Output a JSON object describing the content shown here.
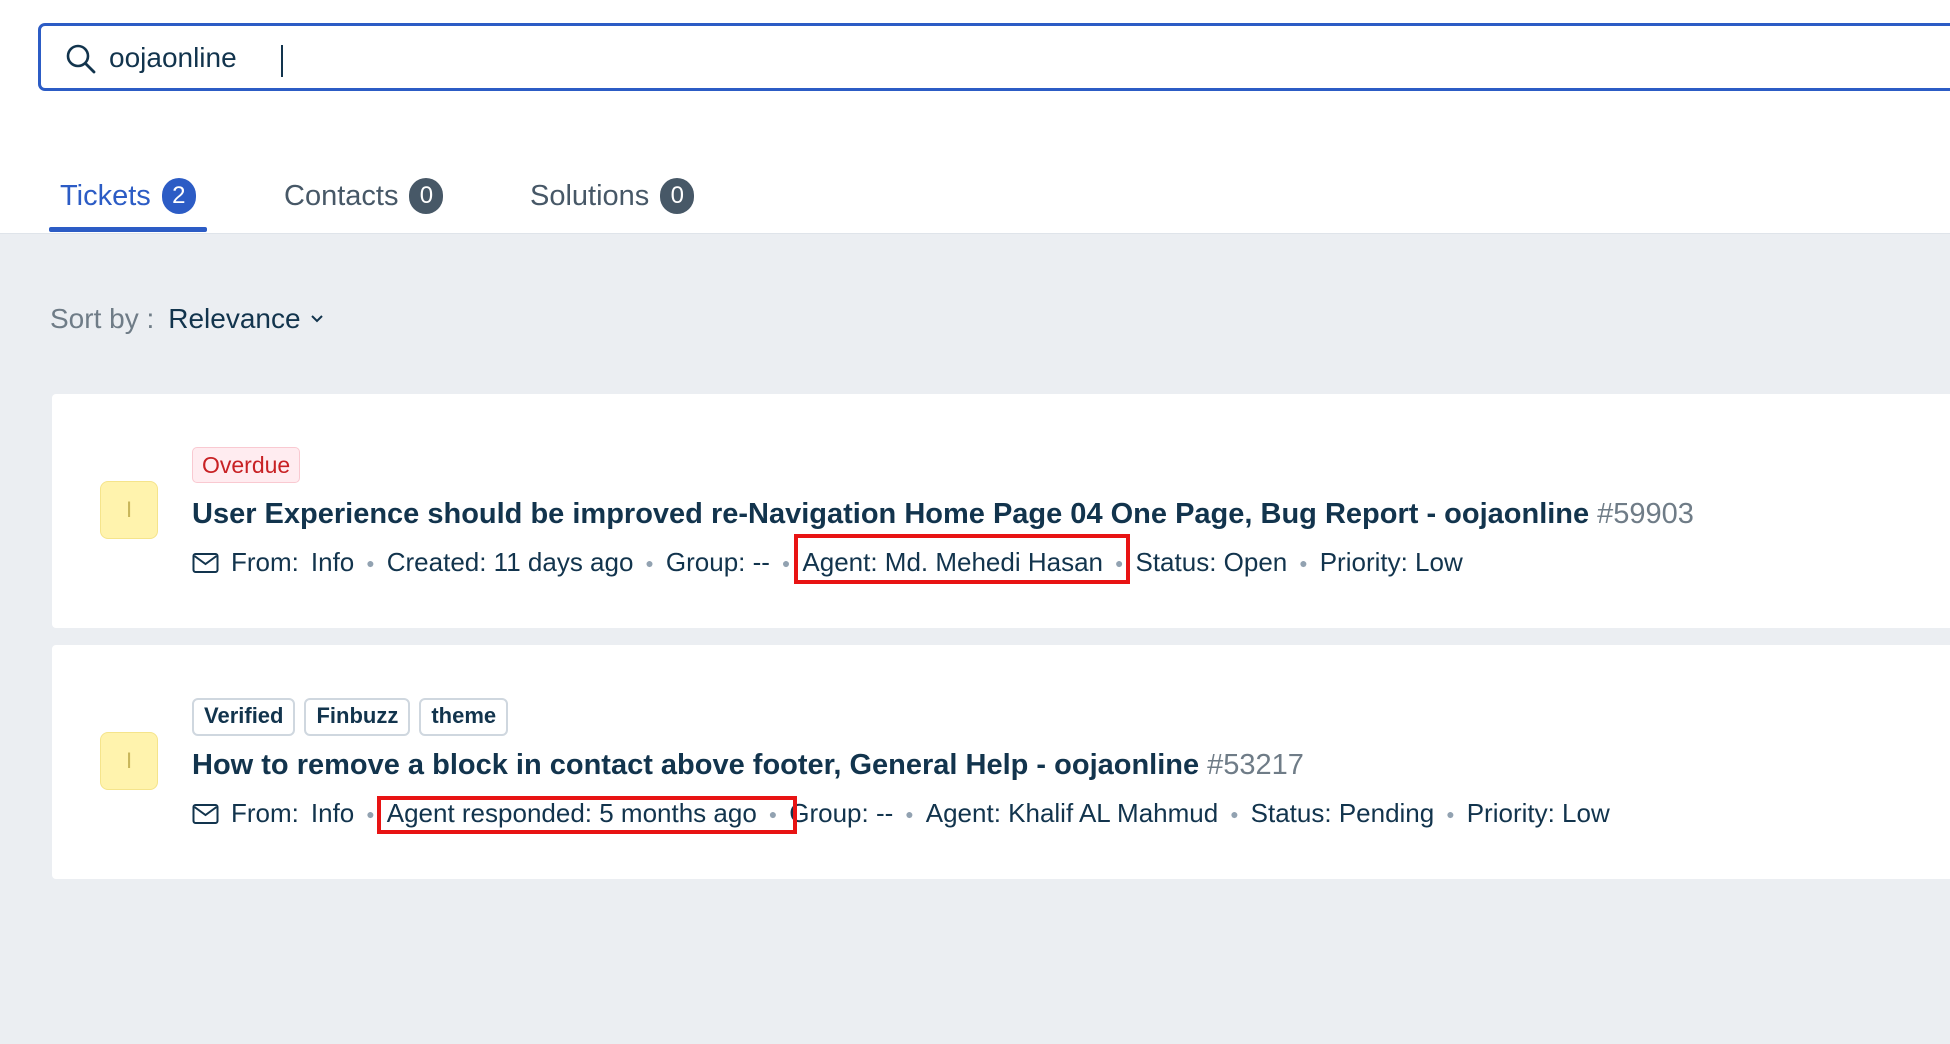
{
  "search": {
    "value": "oojaonline",
    "placeholder": ""
  },
  "tabs": [
    {
      "label": "Tickets",
      "count": "2",
      "active": true
    },
    {
      "label": "Contacts",
      "count": "0",
      "active": false
    },
    {
      "label": "Solutions",
      "count": "0",
      "active": false
    }
  ],
  "sort": {
    "label": "Sort by :",
    "value": "Relevance"
  },
  "tickets": [
    {
      "avatar": "I",
      "status_tag": "Overdue",
      "title": "User Experience should be improved re-Navigation Home Page 04 One Page, Bug Report - oojaonline",
      "id": "#59903",
      "from_label": "From:",
      "from": "Info",
      "time": "Created: 11 days ago",
      "group": "Group: --",
      "agent": "Agent: Md. Mehedi Hasan",
      "status": "Status: Open",
      "priority": "Priority: Low"
    },
    {
      "avatar": "I",
      "tags": [
        "Verified",
        "Finbuzz",
        "theme"
      ],
      "title": "How to remove a block in contact above footer, General Help - oojaonline",
      "id": "#53217",
      "from_label": "From:",
      "from": "Info",
      "time": "Agent responded: 5 months ago",
      "group": "Group: --",
      "agent": "Agent: Khalif AL Mahmud",
      "status": "Status: Pending",
      "priority": "Priority: Low"
    }
  ],
  "colors": {
    "accent": "#2c5cc5",
    "highlight": "#e81313",
    "overdue": "#c82124"
  }
}
